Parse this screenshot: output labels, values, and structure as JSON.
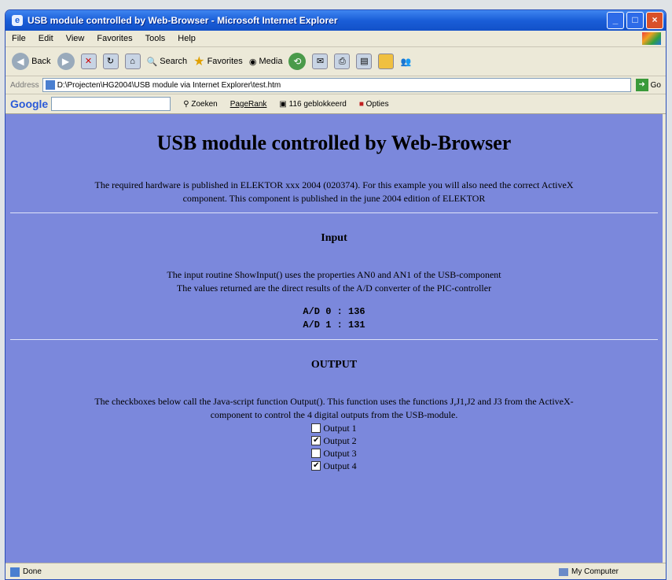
{
  "window": {
    "title": "USB module controlled by Web-Browser - Microsoft Internet Explorer"
  },
  "menu": [
    "File",
    "Edit",
    "View",
    "Favorites",
    "Tools",
    "Help"
  ],
  "toolbar": {
    "back": "Back",
    "search": "Search",
    "favorites": "Favorites",
    "media": "Media"
  },
  "address": {
    "label": "Address",
    "value": "D:\\Projecten\\HG2004\\USB module via Internet Explorer\\test.htm",
    "go": "Go"
  },
  "googlebar": {
    "logo": "Google",
    "search_label": "Zoeken",
    "pagerank": "PageRank",
    "blocked": "116 geblokkeerd",
    "options": "Opties"
  },
  "page": {
    "title": "USB module controlled by Web-Browser",
    "intro_line1": "The required hardware is published in ELEKTOR xxx 2004 (020374). For this example you will also need the correct ActiveX",
    "intro_line2": "component. This component is published in the june 2004 edition of ELEKTOR",
    "input_heading": "Input",
    "input_line1": "The input routine ShowInput() uses the properties AN0 and AN1 of the USB-component",
    "input_line2": "The values returned are the direct results of the A/D converter of the PIC-controller",
    "ad0": "A/D 0 : 136",
    "ad1": "A/D 1 : 131",
    "output_heading": "OUTPUT",
    "output_line1": "The checkboxes below call the Java-script function Output(). This function uses the functions J,J1,J2 and J3 from the ActiveX-",
    "output_line2": "component to control the 4 digital outputs from the USB-module.",
    "outputs": [
      {
        "label": "Output 1",
        "checked": false
      },
      {
        "label": "Output 2",
        "checked": true
      },
      {
        "label": "Output 3",
        "checked": false
      },
      {
        "label": "Output 4",
        "checked": true
      }
    ]
  },
  "status": {
    "text": "Done",
    "zone": "My Computer"
  }
}
